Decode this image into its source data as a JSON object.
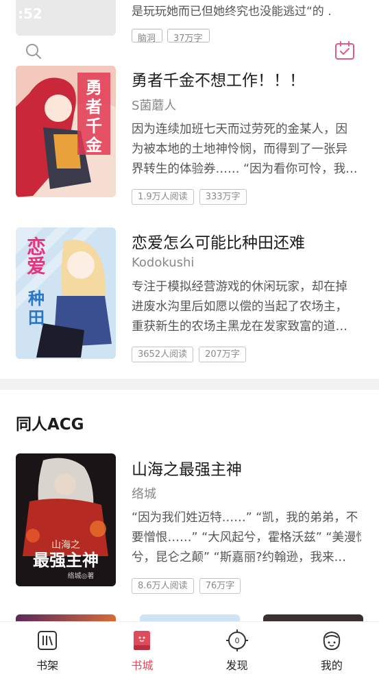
{
  "top_partial": {
    "status_time": ":52",
    "description": "是玩玩她而已但她终究也没能逃过“的 .",
    "tags": [
      "脑洞",
      "37万字"
    ]
  },
  "featured_books": [
    {
      "title": "勇者千金不想工作！！！",
      "author": "S菌蘑人",
      "desc_lines": [
        "因为连续加班七天而过劳死的金某人，因",
        "为被本地的土地神怜悯，而得到了一张异",
        "界转生的体验券…… “因为看你可怜，我…"
      ],
      "reads": "1.9万人阅读",
      "words": "333万字",
      "cover_colors": [
        "#f3d3c8",
        "#c8283a",
        "#e9a13b"
      ]
    },
    {
      "title": "恋爱怎么可能比种田还难",
      "author": "Kodokushi",
      "desc_lines": [
        "专注于模拟经营游戏的休闲玩家，却在掉",
        "进废水沟里后如愿以偿的当起了农场主，",
        "重获新生的农场主黑龙在发家致富的道…"
      ],
      "reads": "3652人阅读",
      "words": "207万字",
      "cover_colors": [
        "#cfe3f3",
        "#f4d9a0",
        "#3a4f8f"
      ]
    }
  ],
  "section": {
    "title": "同人ACG"
  },
  "acg_book": {
    "title": "山海之最强主神",
    "author": "络城",
    "desc_lines": [
      "“因为我们姓迈特……” “凯，我的弟弟，不",
      "要憎恨……” “大风起兮，霍格沃兹” “美漫惊",
      "兮，昆仑之颠” “斯嘉丽?约翰逊，我来…"
    ],
    "reads": "8.6万人阅读",
    "words": "76万字",
    "cover_colors": [
      "#1a1416",
      "#b52a22",
      "#e8e3dc"
    ]
  },
  "tabbar": {
    "items": [
      {
        "label": "书架",
        "icon": "bookshelf-icon",
        "active": false
      },
      {
        "label": "书城",
        "icon": "bookstore-icon",
        "active": true
      },
      {
        "label": "发现",
        "icon": "compass-icon",
        "active": false
      },
      {
        "label": "我的",
        "icon": "profile-icon",
        "active": false
      }
    ],
    "active_color": "#e04a5a"
  }
}
